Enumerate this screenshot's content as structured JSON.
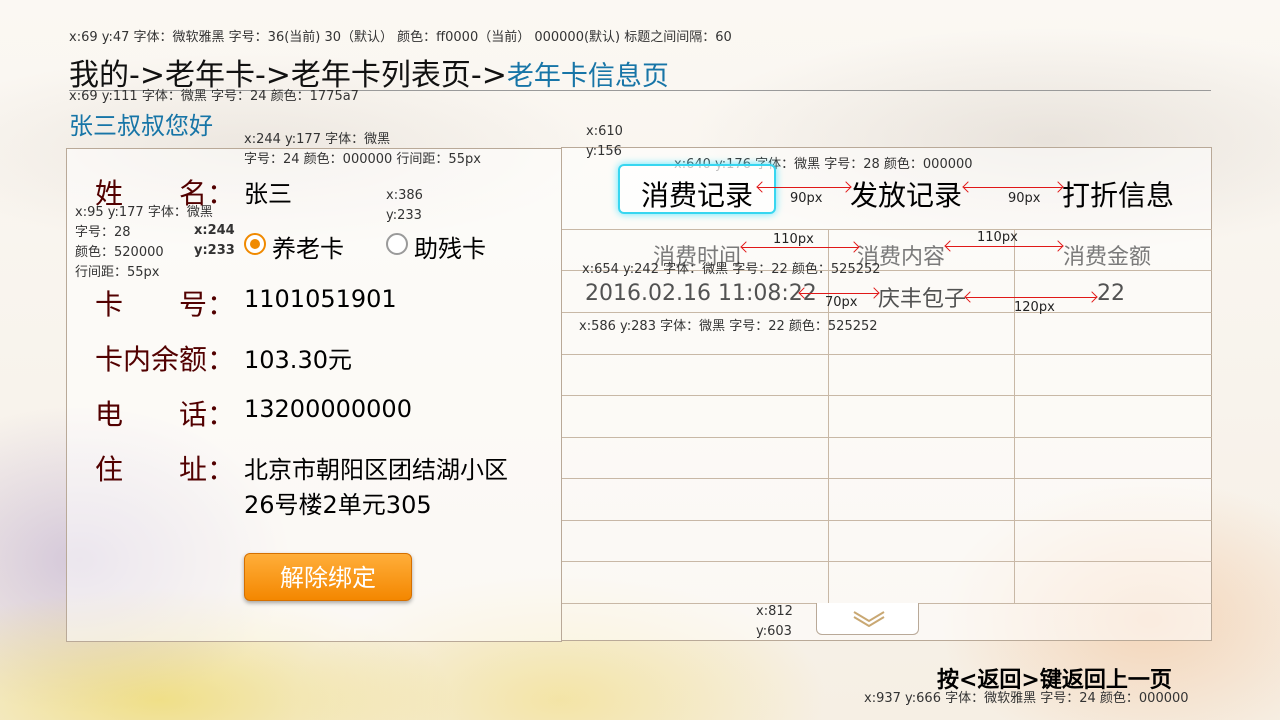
{
  "annotations": {
    "title": "x:69   y:47    字体：微软雅黑    字号：36(当前)    30（默认）    颜色：ff0000（当前）   000000(默认)    标题之间间隔：60",
    "greeting": "x:69  y:111    字体：微黑    字号：24   颜色：1775a7",
    "value_x": "x:244 y:177   字体：微黑",
    "value_spec": "字号：24  颜色：000000    行间距：55px",
    "label_pos": "x:95 y:177   字体：微黑",
    "label_size": "字号：28",
    "label_color": "颜色：520000",
    "label_spacing": "行间距：55px",
    "radio1_x": "x:244",
    "radio1_y": "y:233",
    "radio2_x": "x:386",
    "radio2_y": "y:233",
    "panel_x": "x:610",
    "panel_y": "y:156",
    "tabs": "x:640  y:176    字体：微黑    字号：28   颜色：000000",
    "row_first": "x:654  y:242    字体：微黑    字号：22   颜色：525252",
    "row_second": "x:586  y:283    字体：微黑    字号：22   颜色：525252",
    "down_x": "x:812",
    "down_y": "y:603",
    "footer": "x:937   y:666    字体：微软雅黑     字号：24    颜色：000000",
    "gap_tabs_1": "90px",
    "gap_tabs_2": "90px",
    "gap_hdr_1": "110px",
    "gap_hdr_2": "110px",
    "gap_row_1": "70px",
    "gap_row_2": "120px"
  },
  "breadcrumb": {
    "path": "我的->老年卡->老年卡列表页->",
    "current": "老年卡信息页"
  },
  "greeting": "张三叔叔您好",
  "info": {
    "name_label": "姓　　名：",
    "name_value": "张三",
    "card_types": [
      "养老卡",
      "助残卡"
    ],
    "selected_card_type": "养老卡",
    "card_no_label": "卡　　号：",
    "card_no_value": "1101051901",
    "balance_label": "卡内余额：",
    "balance_value": "103.30元",
    "phone_label": "电　　话：",
    "phone_value": "13200000000",
    "address_label": "住　　址：",
    "address_line1": "北京市朝阳区团结湖小区",
    "address_line2": "26号楼2单元305",
    "unbind_button": "解除绑定"
  },
  "tabs": [
    "消费记录",
    "发放记录",
    "打折信息"
  ],
  "active_tab": "消费记录",
  "table": {
    "headers": [
      "消费时间",
      "消费内容",
      "消费金额"
    ],
    "rows": [
      [
        "2016.02.16  11:08:22",
        "庆丰包子",
        "22"
      ]
    ]
  },
  "footer_hint": "按<返回>键返回上一页",
  "colors": {
    "label": "#520000",
    "greeting": "#1775a7",
    "cell": "#525252",
    "focus": "#37d6f0",
    "button": "#f48700"
  },
  "icons": {
    "scroll_down": "chevron-down-icon"
  }
}
